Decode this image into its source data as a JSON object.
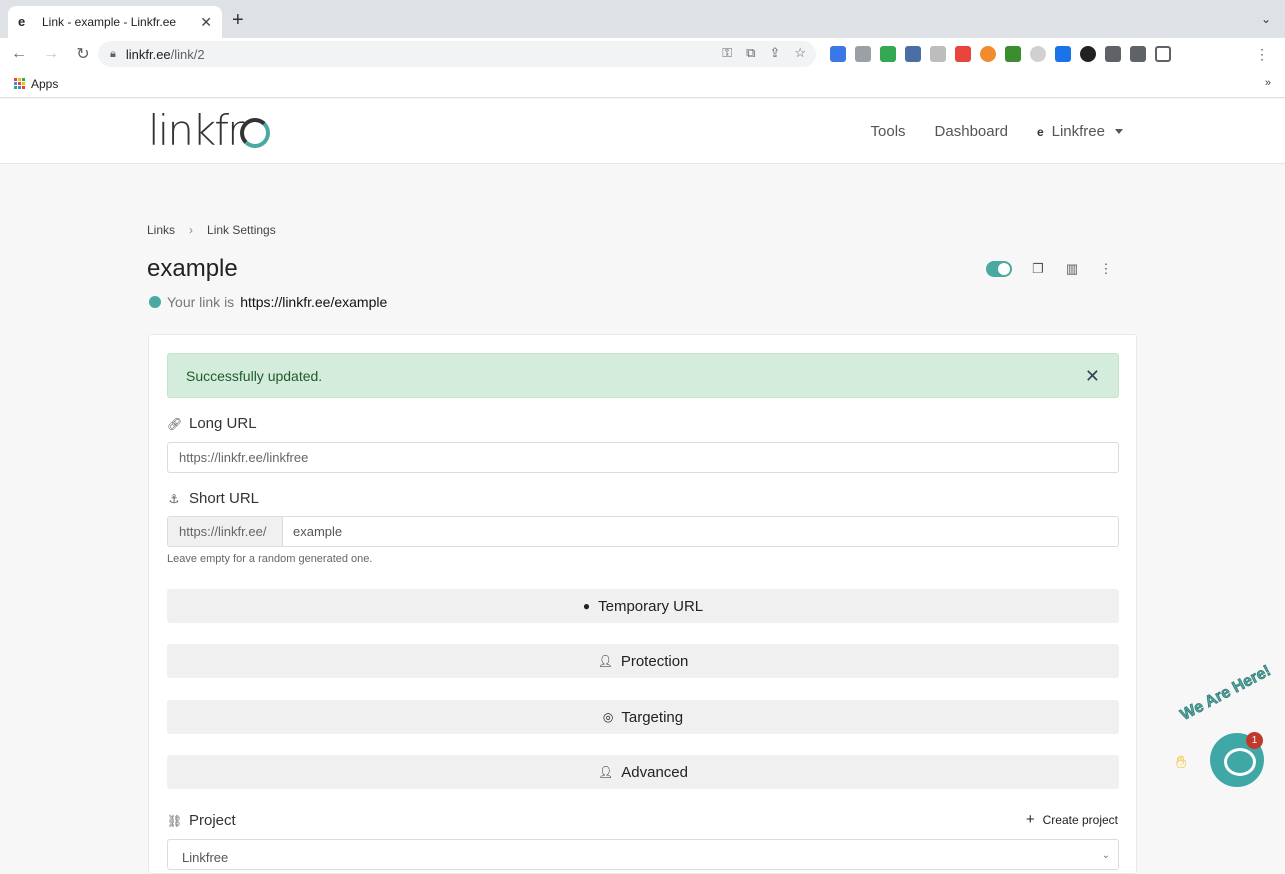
{
  "browser": {
    "tab_title": "Link - example - Linkfr.ee",
    "tab_close": "✕",
    "new_tab": "+",
    "url_host": "linkfr.ee",
    "url_path": "/link/2",
    "bookmarks_apps": "Apps",
    "bookmarks_more": "»"
  },
  "header": {
    "logo_text": "linkfr",
    "nav": {
      "tools": "Tools",
      "dashboard": "Dashboard",
      "account": "Linkfree"
    }
  },
  "breadcrumb": {
    "links": "Links",
    "sep": "›",
    "current": "Link Settings"
  },
  "page": {
    "title": "example",
    "link_prefix": "Your link is",
    "link_url": "https://linkfr.ee/example",
    "enabled": true
  },
  "alert": {
    "message": "Successfully updated.",
    "close": "✕"
  },
  "form": {
    "long_url_label": "Long URL",
    "long_url_value": "https://linkfr.ee/linkfree",
    "short_url_label": "Short URL",
    "short_url_prefix": "https://linkfr.ee/",
    "short_url_value": "example",
    "short_url_help": "Leave empty for a random generated one.",
    "sections": [
      "Temporary URL",
      "Protection",
      "Targeting",
      "Advanced"
    ],
    "project_label": "Project",
    "create_project": "Create project",
    "project_value": "Linkfree"
  },
  "chat": {
    "label": "We Are Here!",
    "badge": "1"
  },
  "colors": {
    "accent": "#4aa9a0",
    "alert_bg": "#d4ecdb",
    "alert_text": "#1f5b2c"
  }
}
